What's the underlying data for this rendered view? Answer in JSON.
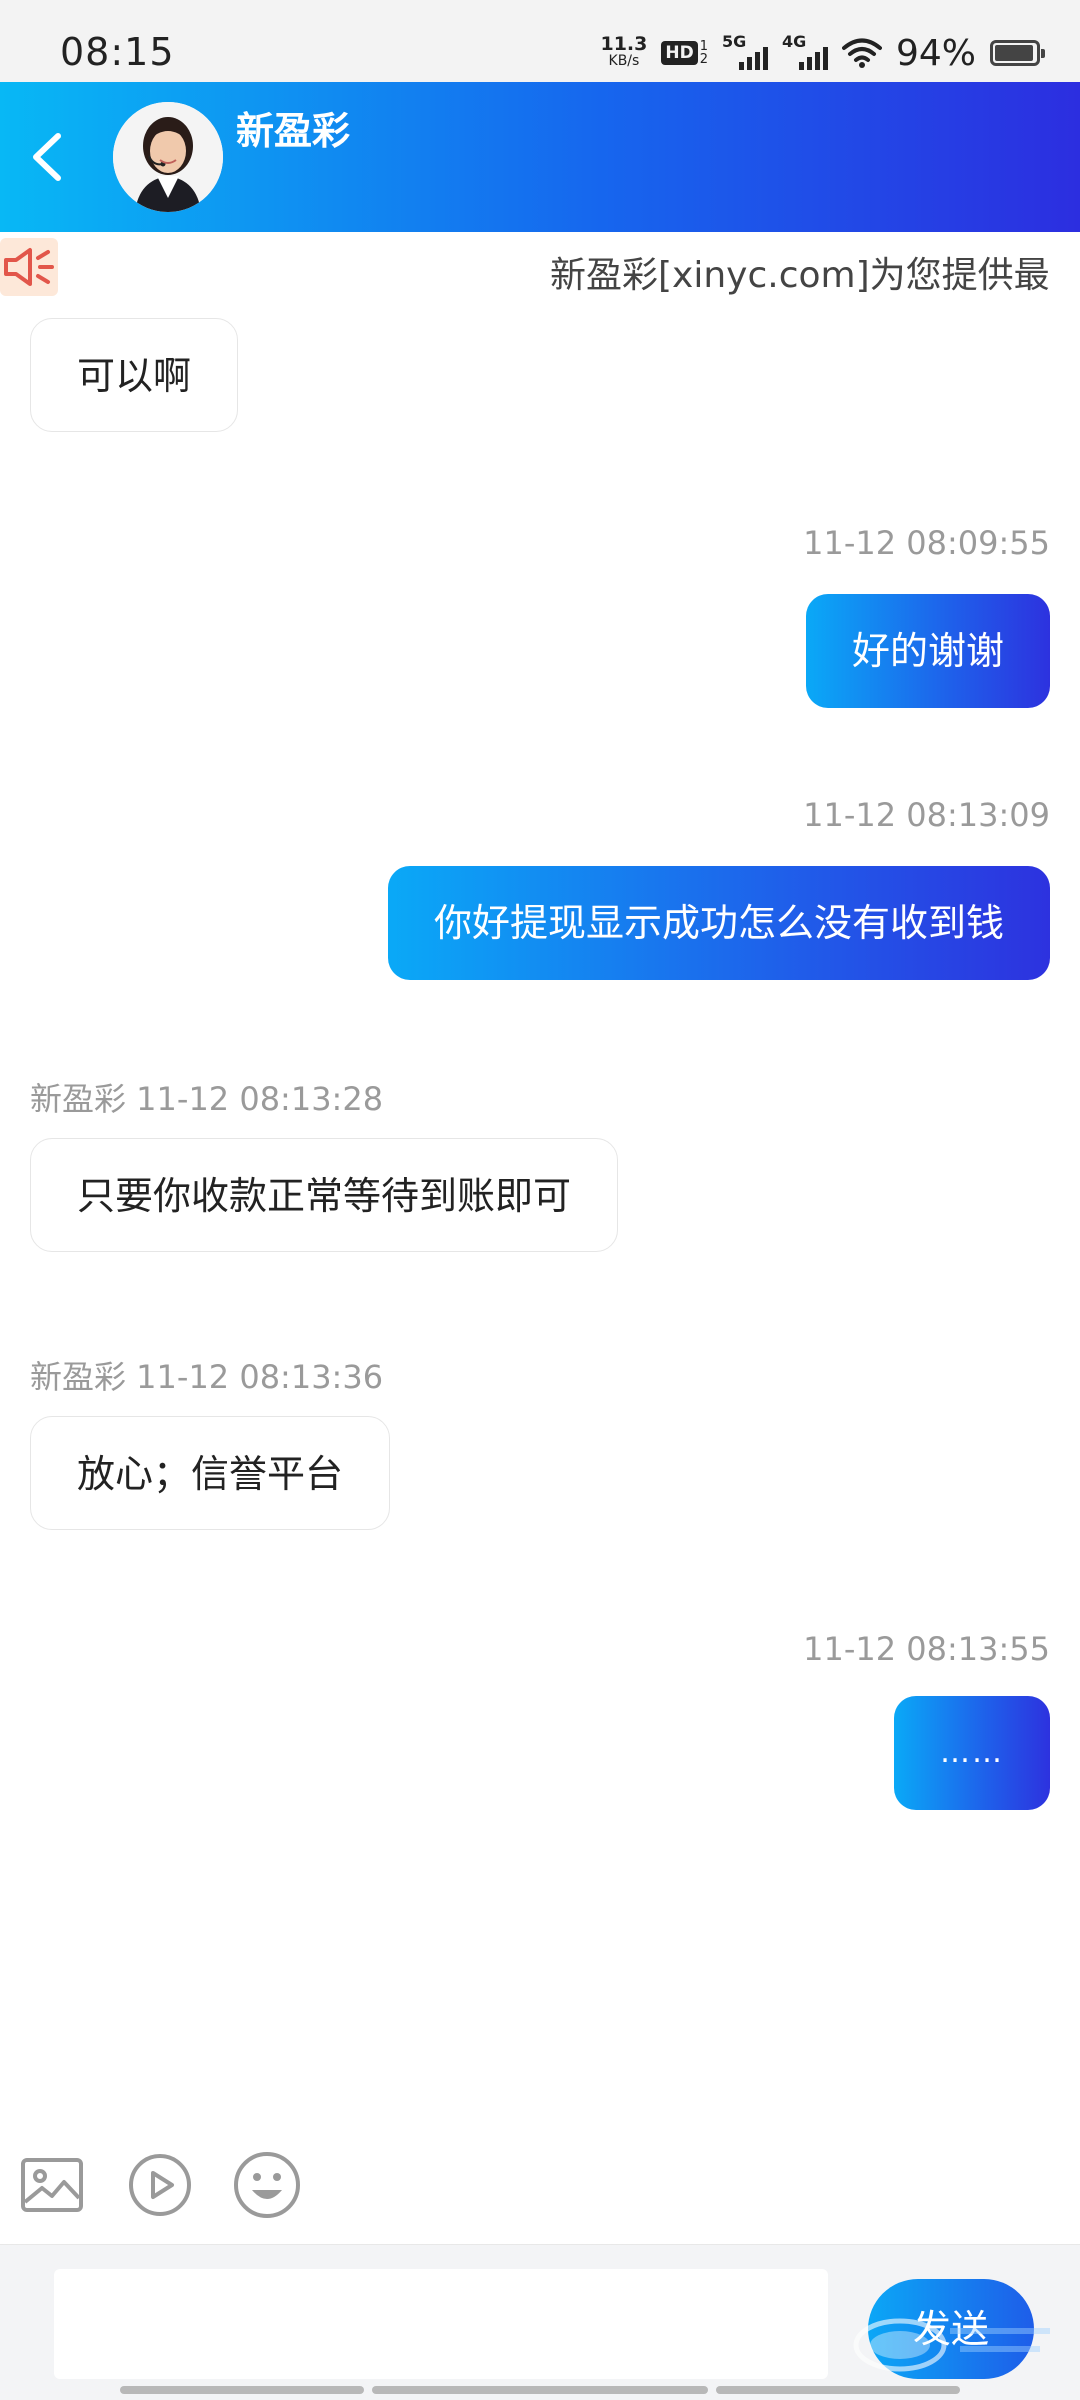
{
  "status_bar": {
    "time": "08:15",
    "net_speed_value": "11.3",
    "net_speed_unit": "KB/s",
    "hd_label": "HD",
    "hd_sub_top": "1",
    "hd_sub_bottom": "2",
    "sig1_label": "5G",
    "sig2_label": "4G",
    "battery_percent": "94%",
    "battery_level": 0.94
  },
  "header": {
    "title": "新盈彩",
    "back_icon": "chevron-left-icon",
    "gradient": [
      "#08b8f5",
      "#1667ee",
      "#2c2ee0"
    ]
  },
  "notice": {
    "icon": "megaphone-icon",
    "text": "新盈彩[xinyc.com]为您提供最"
  },
  "messages": [
    {
      "side": "in",
      "text": "可以啊"
    },
    {
      "side": "out",
      "time": "11-12 08:09:55",
      "text": "好的谢谢"
    },
    {
      "side": "out",
      "time": "11-12 08:13:09",
      "text": "你好提现显示成功怎么没有收到钱"
    },
    {
      "side": "in",
      "meta": "新盈彩 11-12 08:13:28",
      "text": "只要你收款正常等待到账即可"
    },
    {
      "side": "in",
      "meta": "新盈彩 11-12 08:13:36",
      "text": "放心；信誉平台"
    },
    {
      "side": "out",
      "time": "11-12 08:13:55",
      "text": "……"
    }
  ],
  "toolbar": {
    "icons": [
      "image-icon",
      "video-play-icon",
      "emoji-icon"
    ]
  },
  "input": {
    "placeholder": "",
    "value": "",
    "send_label": "发送"
  },
  "colors": {
    "accent_start": "#0aa9f7",
    "accent_end": "#2d32df",
    "meta_text": "#9a9a9a"
  }
}
